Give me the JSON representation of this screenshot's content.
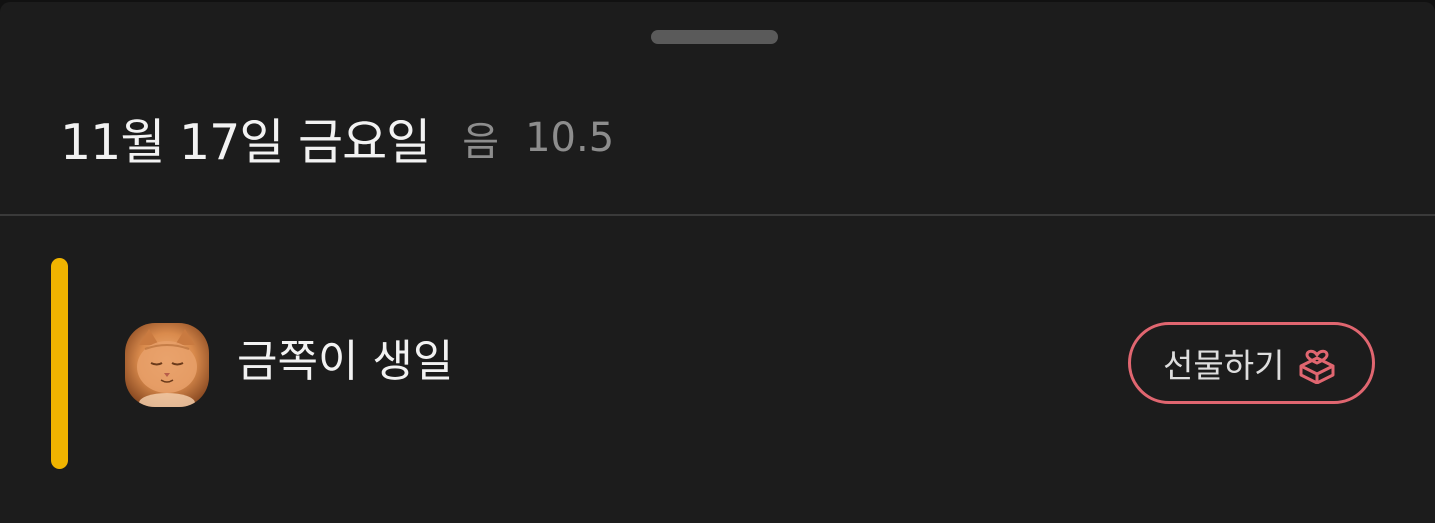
{
  "header": {
    "date_title": "11월 17일 금요일",
    "lunar_label": "음",
    "lunar_date": "10.5"
  },
  "event": {
    "title": "금쪽이 생일",
    "accent_color": "#f0b400",
    "avatar": "orange-cat-photo"
  },
  "gift_button": {
    "label": "선물하기",
    "icon": "gift-box-heart-icon",
    "accent_color": "#e06670"
  }
}
